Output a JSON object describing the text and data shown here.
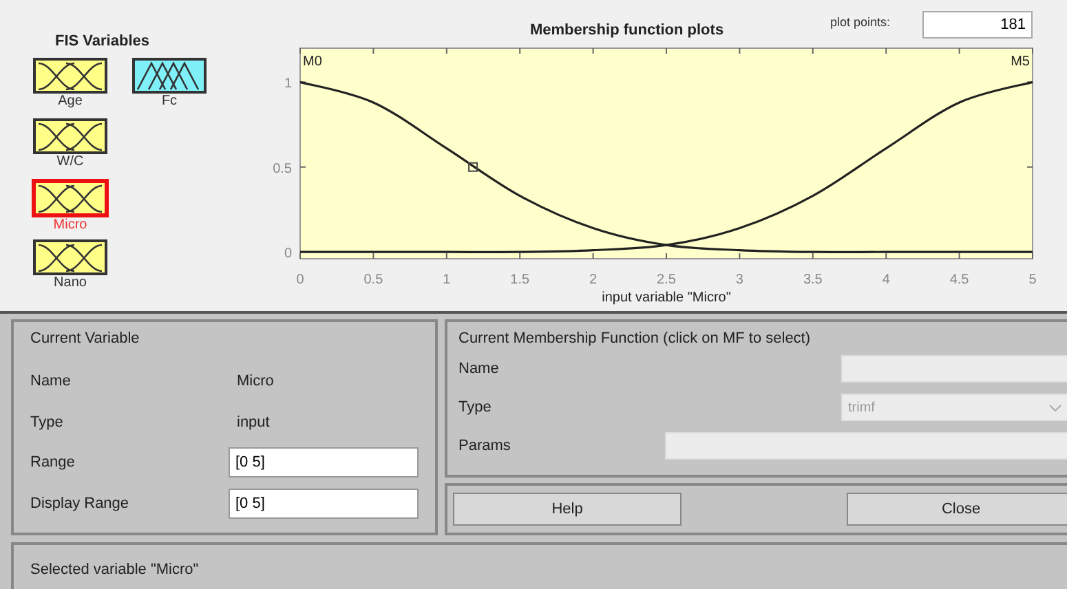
{
  "variables_panel": {
    "title": "FIS Variables",
    "variables": [
      {
        "label": "Age",
        "kind": "input",
        "selected": false
      },
      {
        "label": "Fc",
        "kind": "output",
        "selected": false
      },
      {
        "label": "W/C",
        "kind": "input",
        "selected": false
      },
      {
        "label": "Micro",
        "kind": "input",
        "selected": true
      },
      {
        "label": "Nano",
        "kind": "input",
        "selected": false
      }
    ]
  },
  "plot": {
    "plot_points_label": "plot points:",
    "plot_points": "181",
    "chart_data": {
      "type": "line",
      "title": "Membership function plots",
      "xlabel": "input variable \"Micro\"",
      "x": [
        0,
        0.5,
        1,
        1.5,
        2,
        2.5,
        3,
        3.5,
        4,
        4.5,
        5
      ],
      "series": [
        {
          "name": "M0",
          "color": "#222222",
          "values": [
            1,
            0.88,
            0.61,
            0.33,
            0.14,
            0.04,
            0.01,
            0,
            0,
            0,
            0
          ]
        },
        {
          "name": "M5",
          "color": "#222222",
          "values": [
            0,
            0,
            0,
            0,
            0.01,
            0.04,
            0.14,
            0.33,
            0.61,
            0.88,
            1
          ]
        }
      ],
      "xlim": [
        0,
        5
      ],
      "ylim": [
        -0.04,
        1.2
      ],
      "xticks": [
        0,
        0.5,
        1,
        1.5,
        2,
        2.5,
        3,
        3.5,
        4,
        4.5,
        5
      ],
      "yticks": [
        0,
        0.5,
        1
      ]
    }
  },
  "current_variable": {
    "title": "Current Variable",
    "rows": [
      {
        "label": "Name",
        "value": "Micro",
        "kind": "text"
      },
      {
        "label": "Type",
        "value": "input",
        "kind": "text"
      },
      {
        "label": "Range",
        "value": "[0 5]",
        "kind": "field"
      },
      {
        "label": "Display Range",
        "value": "[0 5]",
        "kind": "field"
      }
    ]
  },
  "current_mf": {
    "title": "Current Membership Function (click on MF to select)",
    "name_label": "Name",
    "type_label": "Type",
    "type_value": "trimf",
    "params_label": "Params"
  },
  "buttons": [
    "Help",
    "Close"
  ],
  "status_bar": "Selected variable \"Micro\""
}
